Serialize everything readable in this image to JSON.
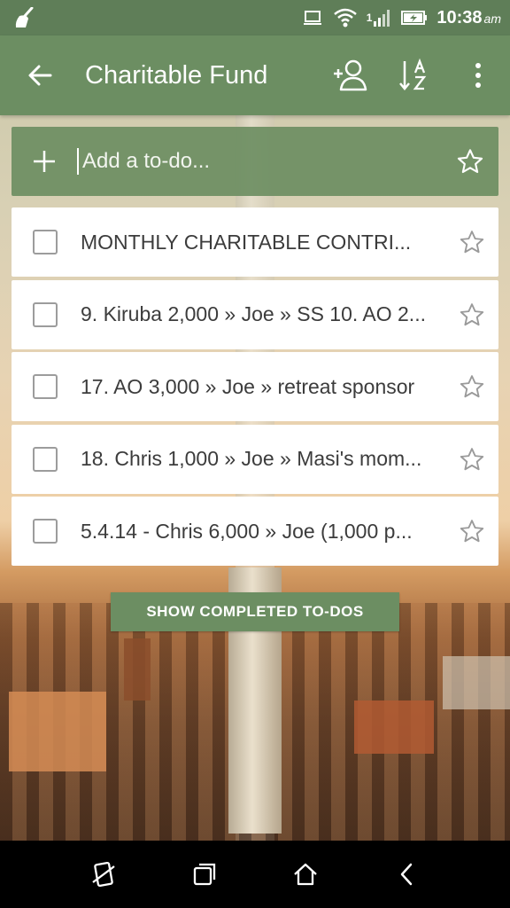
{
  "status_bar": {
    "time": "10:38",
    "ampm": "am",
    "icons": [
      "broom-icon",
      "screen-icon",
      "wifi-icon",
      "signal-icon",
      "battery-charging-icon"
    ],
    "signal_label": "1"
  },
  "toolbar": {
    "title": "Charitable Fund",
    "icons": [
      "back-arrow-icon",
      "add-person-icon",
      "sort-az-icon",
      "more-vert-icon"
    ]
  },
  "add_bar": {
    "placeholder": "Add a to-do...",
    "icons": [
      "plus-icon",
      "star-outline-icon"
    ]
  },
  "todos": [
    {
      "text": "MONTHLY CHARITABLE CONTRI...",
      "starred": false,
      "done": false
    },
    {
      "text": "9. Kiruba 2,000 » Joe » SS 10. AO 2...",
      "starred": false,
      "done": false
    },
    {
      "text": "17. AO 3,000 » Joe » retreat sponsor",
      "starred": false,
      "done": false
    },
    {
      "text": "18. Chris 1,000 » Joe » Masi's mom...",
      "starred": false,
      "done": false
    },
    {
      "text": "5.4.14 - Chris 6,000 » Joe (1,000 p...",
      "starred": false,
      "done": false
    }
  ],
  "show_completed_label": "SHOW COMPLETED TO-DOS",
  "nav_bar": {
    "icons": [
      "rotate-icon",
      "recents-icon",
      "home-icon",
      "back-icon"
    ]
  },
  "colors": {
    "accent": "#6c8e62",
    "status_bar": "#5f7e58",
    "nav_bar": "#000000"
  }
}
